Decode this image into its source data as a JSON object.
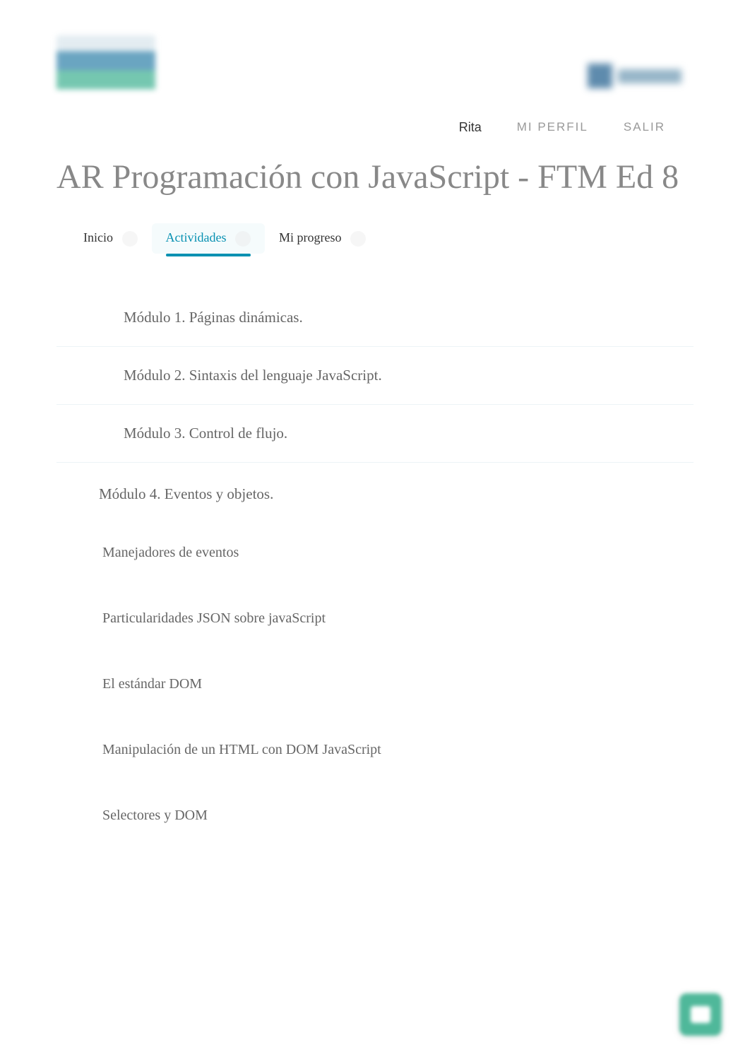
{
  "header": {
    "user_name": "Rita",
    "nav_profile": "MI PERFIL",
    "nav_logout": "SALIR"
  },
  "page": {
    "title": "AR Programación con JavaScript - FTM Ed 8"
  },
  "tabs": [
    {
      "label": "Inicio",
      "active": false
    },
    {
      "label": "Actividades",
      "active": true
    },
    {
      "label": "Mi progreso",
      "active": false
    }
  ],
  "modules": [
    {
      "title": "Módulo 1. Páginas dinámicas."
    },
    {
      "title": "Módulo 2. Sintaxis del lenguaje JavaScript."
    },
    {
      "title": "Módulo 3. Control de flujo."
    }
  ],
  "expanded_module": {
    "title": "Módulo 4. Eventos y objetos.",
    "items": [
      "Manejadores de eventos",
      "Particularidades JSON sobre javaScript",
      "El estándar DOM",
      "Manipulación de un HTML con DOM JavaScript",
      "Selectores y DOM"
    ]
  }
}
